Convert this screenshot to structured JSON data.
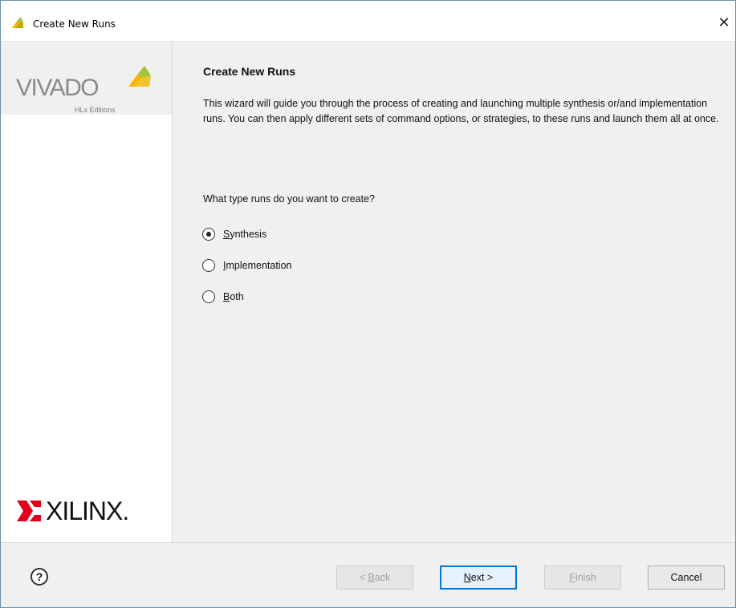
{
  "window": {
    "title": "Create New Runs",
    "close_glyph": "✕"
  },
  "sidebar": {
    "product_name": "VIVADO",
    "edition": "HLx Editions",
    "vendor": "XILINX."
  },
  "page": {
    "title": "Create New Runs",
    "description": "This wizard will guide you through the process of creating and launching multiple synthesis or/and implementation runs. You can then apply different sets of command options, or strategies, to these runs and launch them all at once.",
    "question": "What type runs do you want to create?"
  },
  "options": [
    {
      "mnemonic": "S",
      "rest": "ynthesis",
      "selected": true
    },
    {
      "mnemonic": "I",
      "rest": "mplementation",
      "selected": false
    },
    {
      "mnemonic": "B",
      "rest": "oth",
      "selected": false
    }
  ],
  "footer": {
    "help_glyph": "?",
    "back": {
      "prefix": "< ",
      "mnemonic": "B",
      "rest": "ack",
      "enabled": false
    },
    "next": {
      "mnemonic": "N",
      "rest": "ext >",
      "enabled": true
    },
    "finish": {
      "mnemonic": "F",
      "rest": "inish",
      "enabled": false
    },
    "cancel": {
      "label": "Cancel",
      "enabled": true
    }
  },
  "colors": {
    "accent": "#0078d7",
    "logo_yellow": "#f7b500",
    "logo_green": "#a4c43c"
  }
}
